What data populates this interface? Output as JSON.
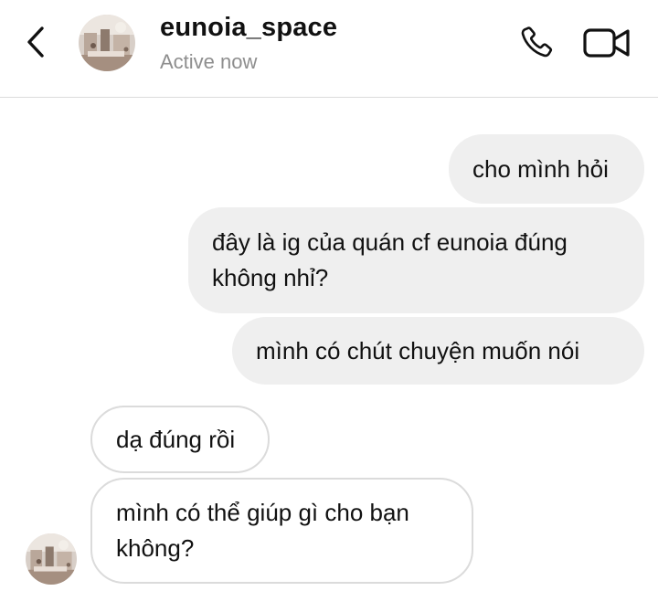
{
  "header": {
    "contact_name": "eunoia_space",
    "status": "Active now",
    "back_icon": "chevron-left-icon",
    "call_icon": "phone-icon",
    "video_icon": "video-camera-icon"
  },
  "messages": [
    {
      "direction": "sent",
      "text": "cho mình hỏi"
    },
    {
      "direction": "sent",
      "text": "đây là ig của quán cf eunoia đúng không nhỉ?"
    },
    {
      "direction": "sent",
      "text": "mình có chút chuyện muốn nói"
    },
    {
      "direction": "received",
      "text": "dạ đúng rồi"
    },
    {
      "direction": "received",
      "text": "mình có thể giúp gì cho bạn không?"
    }
  ],
  "colors": {
    "sent_bubble": "#efefef",
    "received_border": "#dbdbdb",
    "status_text": "#8e8e8e",
    "divider": "#dbdbdb"
  }
}
